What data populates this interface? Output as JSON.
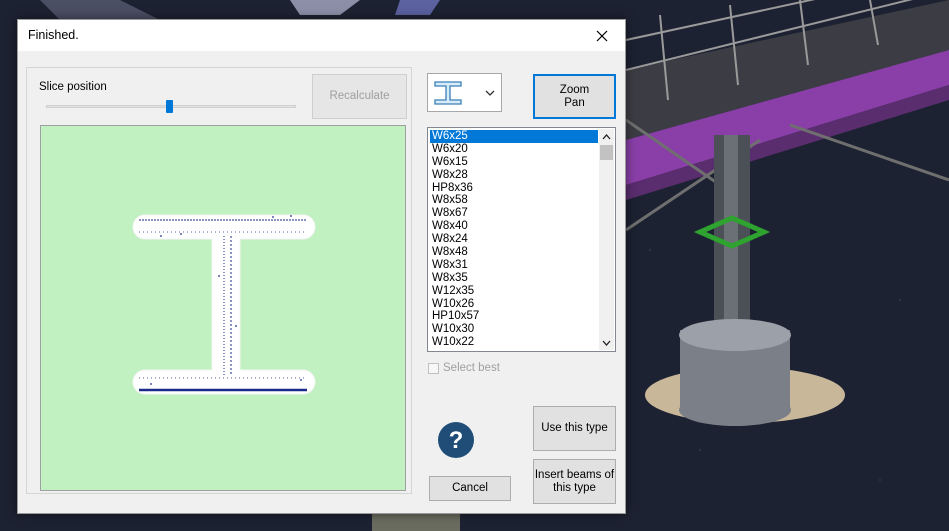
{
  "dialog": {
    "title": "Finished.",
    "close_icon": "close-icon"
  },
  "slice": {
    "label": "Slice position",
    "position_fraction": 0.5,
    "recalculate_label": "Recalculate",
    "recalculate_enabled": false
  },
  "preview": {
    "background": "#c1f0c1",
    "section_fill": "#ffffff",
    "point_color": "#1a2a8a"
  },
  "profile_combo": {
    "selected_icon": "i-beam-icon",
    "dropdown_icon": "chevron-down-icon"
  },
  "zoom_pan": {
    "label_line1": "Zoom",
    "label_line2": "Pan"
  },
  "sections": {
    "items": [
      "W6x25",
      "W6x20",
      "W6x15",
      "W8x28",
      "HP8x36",
      "W8x58",
      "W8x67",
      "W8x40",
      "W8x24",
      "W8x48",
      "W8x31",
      "W8x35",
      "W12x35",
      "W10x26",
      "HP10x57",
      "W10x30",
      "W10x22"
    ],
    "selected_index": 0
  },
  "select_best": {
    "label": "Select best",
    "checked": false,
    "enabled": false
  },
  "buttons": {
    "use_type": "Use this type",
    "insert_line1": "Insert beams of",
    "insert_line2": "this type",
    "cancel": "Cancel"
  },
  "help": {
    "icon": "help-icon",
    "glyph": "?",
    "color": "#1f4d78"
  },
  "colors": {
    "accent": "#0078d7",
    "beam_purple": "#8a3fa8",
    "marker_green": "#2fa32f"
  }
}
